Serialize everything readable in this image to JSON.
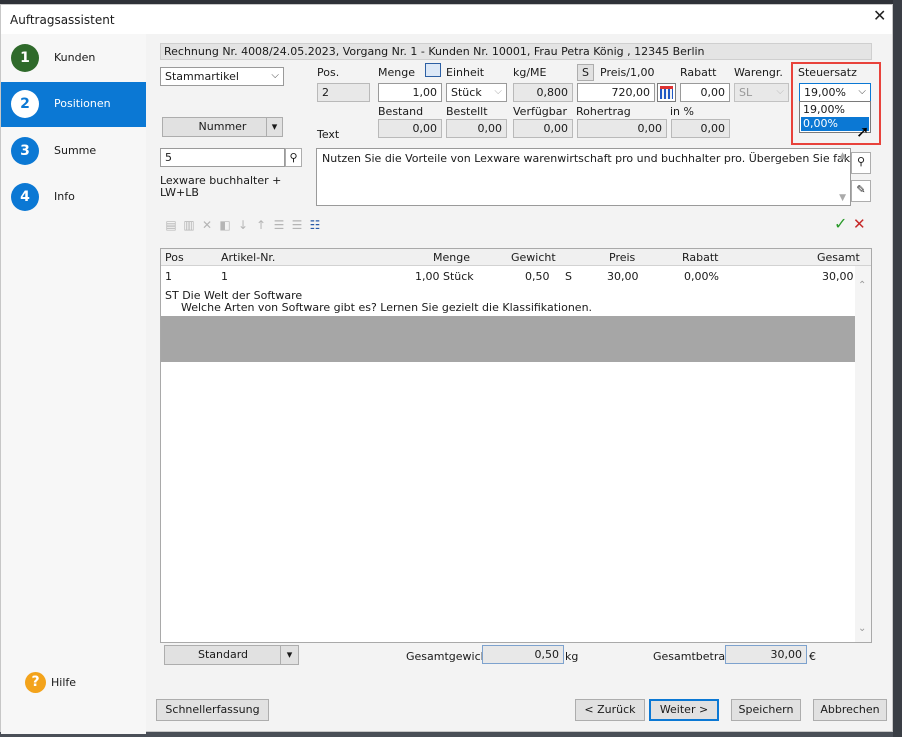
{
  "window": {
    "title": "Auftragsassistent"
  },
  "steps": [
    {
      "num": "1",
      "label": "Kunden",
      "color": "#2f6a2b"
    },
    {
      "num": "2",
      "label": "Positionen",
      "color": "#0b78d4"
    },
    {
      "num": "3",
      "label": "Summe",
      "color": "#0b78d4"
    },
    {
      "num": "4",
      "label": "Info",
      "color": "#0b78d4"
    }
  ],
  "help": {
    "icon": "?",
    "label": "Hilfe"
  },
  "header": {
    "info": "Rechnung Nr. 4008/24.05.2023, Vorgang Nr. 1 - Kunden Nr. 10001, Frau Petra König , 12345 Berlin"
  },
  "article": {
    "type_select": "Stammartikel",
    "nummer_button": "Nummer",
    "search_value": "5",
    "name": "Lexware buchhalter +",
    "name2": "LW+LB"
  },
  "labels": {
    "pos": "Pos.",
    "menge": "Menge",
    "einheit": "Einheit",
    "kg_me": "kg/ME",
    "s": "S",
    "preis": "Preis/1,00",
    "rabatt": "Rabatt",
    "warengr": "Warengr.",
    "steuersatz": "Steuersatz",
    "bestand": "Bestand",
    "bestellt": "Bestellt",
    "verfuegbar": "Verfügbar",
    "rohertrag": "Rohertrag",
    "in_pct": "in %",
    "text": "Text"
  },
  "values": {
    "pos": "2",
    "menge": "1,00",
    "einheit": "Stück",
    "kg_me": "0,800",
    "preis": "720,00",
    "rabatt": "0,00",
    "warengr": "SL",
    "steuersatz": "19,00%",
    "bestand": "0,00",
    "bestellt": "0,00",
    "verfuegbar": "0,00",
    "rohertrag": "0,00",
    "in_pct": "0,00"
  },
  "tax_options": [
    "19,00%",
    "0,00%"
  ],
  "text": "Nutzen Sie die Vorteile von Lexware warenwirtschaft pro und buchhalter pro. Übergeben Sie fakturierte Auft",
  "grid": {
    "headers": [
      "Pos",
      "Artikel-Nr.",
      "Menge",
      "Gewicht",
      "Preis",
      "Rabatt",
      "Gesamt"
    ],
    "row": {
      "pos": "1",
      "artikel": "1",
      "menge": "1,00 Stück",
      "gewicht": "0,50",
      "s": "S",
      "preis": "30,00",
      "rabatt": "0,00%",
      "gesamt": "30,00"
    },
    "desc1": "ST Die Welt der Software",
    "desc2": "Welche Arten von Software gibt es? Lernen Sie gezielt die Klassifikationen."
  },
  "footer": {
    "standard": "Standard",
    "gesamtgewicht_label": "Gesamtgewicht",
    "gesamtgewicht": "0,50",
    "kg": "kg",
    "gesamtbetrag_label": "Gesamtbetrag",
    "gesamtbetrag": "30,00",
    "eur": "€"
  },
  "buttons": {
    "schnellerfassung": "Schnellerfassung",
    "zurueck": "< Zurück",
    "weiter": "Weiter >",
    "speichern": "Speichern",
    "abbrechen": "Abbrechen"
  }
}
